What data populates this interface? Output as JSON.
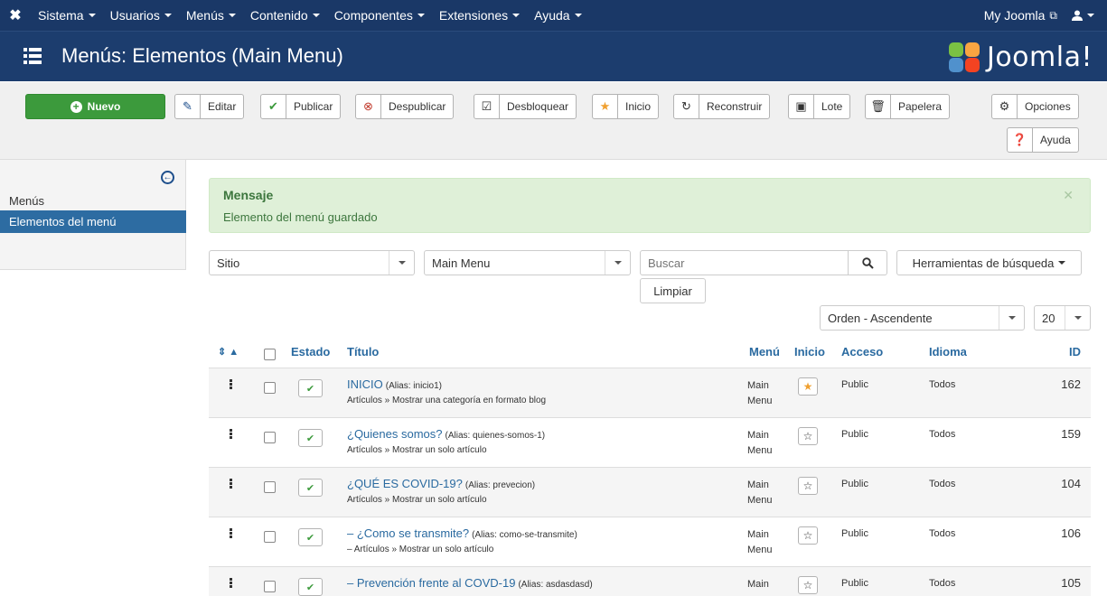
{
  "navbar": {
    "logo": "✖",
    "items": [
      {
        "label": "Sistema"
      },
      {
        "label": "Usuarios"
      },
      {
        "label": "Menús"
      },
      {
        "label": "Contenido"
      },
      {
        "label": "Componentes"
      },
      {
        "label": "Extensiones"
      },
      {
        "label": "Ayuda"
      }
    ],
    "site_link": "My Joomla",
    "user_icon": "user-icon"
  },
  "header": {
    "title": "Menús: Elementos (Main Menu)",
    "brand": "Joomla!"
  },
  "toolbar": {
    "new": "Nuevo",
    "edit": "Editar",
    "publish": "Publicar",
    "unpublish": "Despublicar",
    "unlock": "Desbloquear",
    "home": "Inicio",
    "rebuild": "Reconstruir",
    "batch": "Lote",
    "trash": "Papelera",
    "options": "Opciones",
    "help": "Ayuda"
  },
  "sidebar": {
    "items": [
      {
        "label": "Menús",
        "active": false
      },
      {
        "label": "Elementos del menú",
        "active": true
      }
    ]
  },
  "message": {
    "heading": "Mensaje",
    "text": "Elemento del menú guardado"
  },
  "filters": {
    "client": "Sitio",
    "menu": "Main Menu",
    "search_placeholder": "Buscar",
    "search_tools": "Herramientas de búsqueda",
    "clear": "Limpiar",
    "ordering": "Orden - Ascendente",
    "limit": "20"
  },
  "table": {
    "headers": {
      "sort": "⇕ ▲",
      "state": "Estado",
      "title": "Título",
      "menu": "Menú",
      "home": "Inicio",
      "access": "Acceso",
      "language": "Idioma",
      "id": "ID"
    },
    "rows": [
      {
        "title": "INICIO",
        "alias": "(Alias: inicio1)",
        "type": "Artículos » Mostrar una categoría en formato blog",
        "menu": "Main Menu",
        "home": true,
        "access": "Public",
        "language": "Todos",
        "id": "162"
      },
      {
        "title": "¿Quienes somos?",
        "alias": "(Alias: quienes-somos-1)",
        "type": "Artículos » Mostrar un solo artículo",
        "menu": "Main Menu",
        "home": false,
        "access": "Public",
        "language": "Todos",
        "id": "159"
      },
      {
        "title": "¿QUÉ ES COVID-19?",
        "alias": "(Alias: prevecion)",
        "type": "Artículos » Mostrar un solo artículo",
        "menu": "Main Menu",
        "home": false,
        "access": "Public",
        "language": "Todos",
        "id": "104"
      },
      {
        "title": "– ¿Como se transmite?",
        "alias": "(Alias: como-se-transmite)",
        "type": "– Artículos » Mostrar un solo artículo",
        "menu": "Main Menu",
        "home": false,
        "access": "Public",
        "language": "Todos",
        "id": "106"
      },
      {
        "title": "– Prevención frente al COVD-19",
        "alias": "(Alias: asdasdasd)",
        "type": "",
        "menu": "Main",
        "home": false,
        "access": "Public",
        "language": "Todos",
        "id": "105"
      }
    ]
  }
}
